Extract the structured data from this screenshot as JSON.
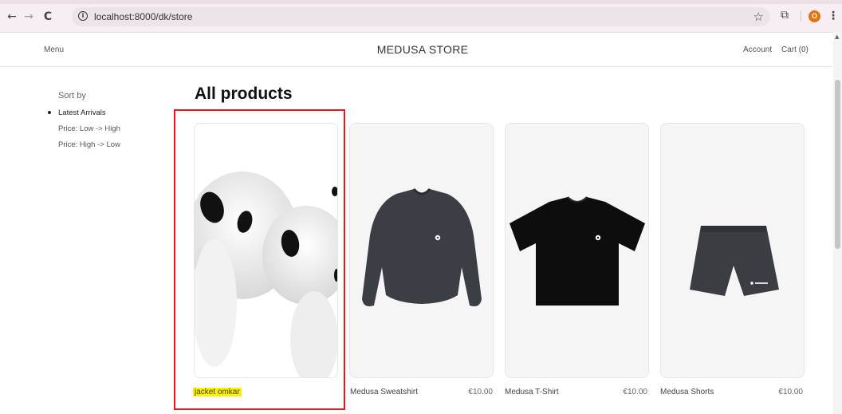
{
  "browser": {
    "url": "localhost:8000/dk/store",
    "back_icon": "←",
    "forward_icon": "→",
    "reload_icon": "C",
    "info_icon": "i",
    "star_icon": "☆",
    "extensions_icon": "⧉",
    "profile_initial": "O",
    "menu_icon": "⋮"
  },
  "header": {
    "menu_label": "Menu",
    "brand": "MEDUSA STORE",
    "account_label": "Account",
    "cart_label": "Cart (0)"
  },
  "sidebar": {
    "sort_title": "Sort by",
    "options": [
      "Latest Arrivals",
      "Price: Low -> High",
      "Price: High -> Low"
    ],
    "selected": "Latest Arrivals"
  },
  "main": {
    "title": "All products",
    "products": [
      {
        "name": "jacket omkar",
        "price": "",
        "image": "earbuds"
      },
      {
        "name": "Medusa Sweatshirt",
        "price": "€10.00",
        "image": "sweatshirt"
      },
      {
        "name": "Medusa T-Shirt",
        "price": "€10.00",
        "image": "t-shirt"
      },
      {
        "name": "Medusa Shorts",
        "price": "€10.00",
        "image": "shorts"
      }
    ]
  },
  "colors": {
    "highlight": "#ffef00",
    "annotation_border": "#e01b24",
    "card_background": "#f5f5f6"
  }
}
